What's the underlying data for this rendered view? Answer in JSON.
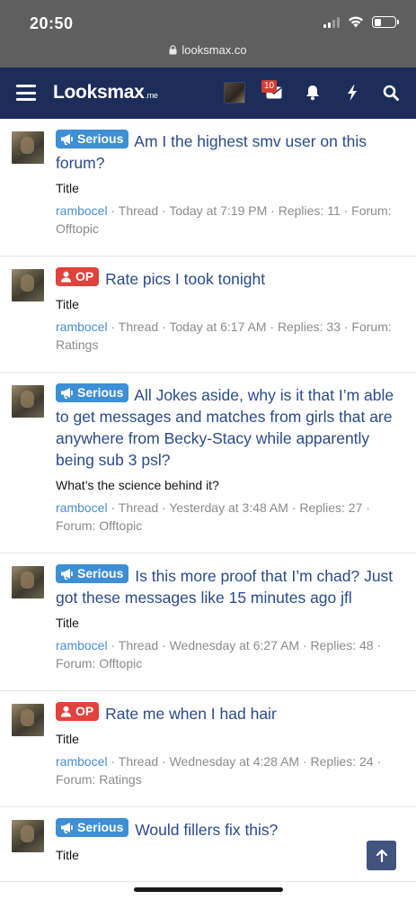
{
  "status_bar": {
    "time": "20:50",
    "url": "looksmax.co"
  },
  "nav": {
    "logo": "Looksmax",
    "logo_tld": ".me",
    "alerts_count": "10"
  },
  "threads": [
    {
      "label": "Serious",
      "label_type": "serious",
      "title": "Am I the highest smv user on this forum?",
      "snippet": "Title",
      "user": "rambocel",
      "meta": " · Thread · Today at 7:19 PM · Replies: 11 · Forum: Offtopic"
    },
    {
      "label": "OP",
      "label_type": "op",
      "title": "Rate pics I took tonight",
      "snippet": "Title",
      "user": "rambocel",
      "meta": " · Thread · Today at 6:17 AM · Replies: 33 · Forum: Ratings"
    },
    {
      "label": "Serious",
      "label_type": "serious",
      "title": "All Jokes aside, why is it that I’m able to get messages and matches from girls that are anywhere from Becky-Stacy while apparently being sub 3 psl?",
      "snippet": "What’s the science behind it?",
      "user": "rambocel",
      "meta": " · Thread · Yesterday at 3:48 AM · Replies: 27 · Forum: Offtopic"
    },
    {
      "label": "Serious",
      "label_type": "serious",
      "title": "Is this more proof that I’m chad? Just got these messages like 15 minutes ago jfl",
      "snippet": "Title",
      "user": "rambocel",
      "meta": " · Thread · Wednesday at 6:27 AM · Replies: 48 · Forum: Offtopic"
    },
    {
      "label": "OP",
      "label_type": "op",
      "title": "Rate me when I had hair",
      "snippet": "Title",
      "user": "rambocel",
      "meta": " · Thread · Wednesday at 4:28 AM · Replies: 24 · Forum: Ratings"
    },
    {
      "label": "Serious",
      "label_type": "serious",
      "title": "Would fillers fix this?",
      "snippet": "Title",
      "user": "",
      "meta": ""
    }
  ],
  "colors": {
    "nav_bg": "#1c2d5a",
    "link": "#2b4b8b",
    "serious": "#3d8fd6",
    "op": "#e0423c"
  }
}
